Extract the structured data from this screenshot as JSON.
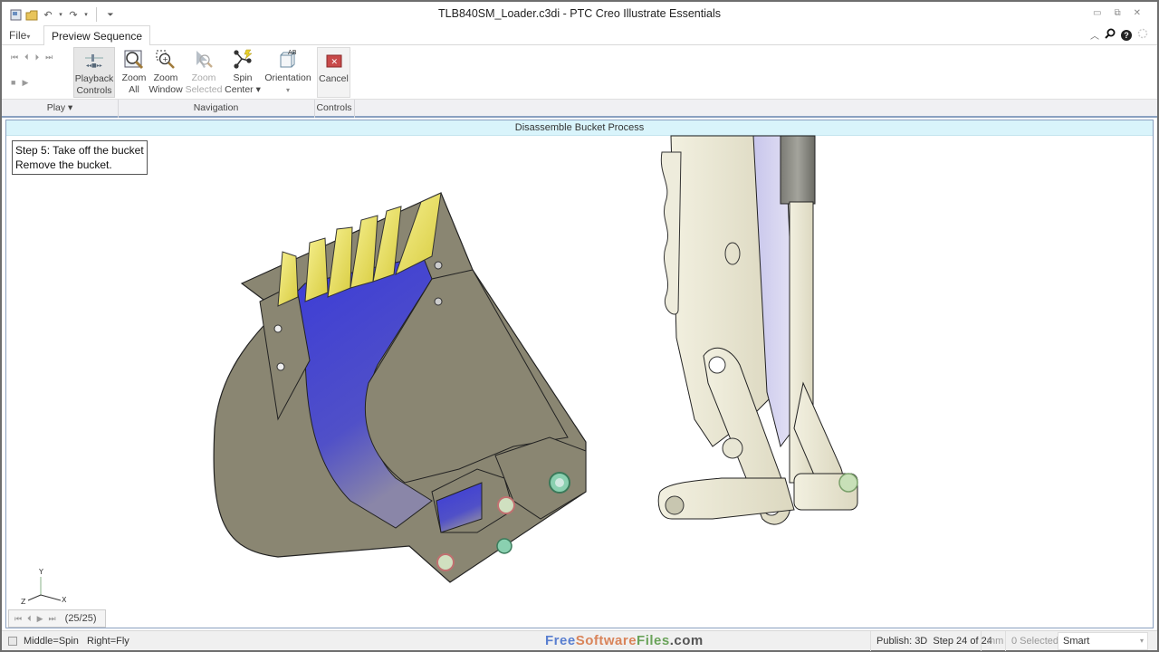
{
  "window": {
    "title": "TLB840SM_Loader.c3di - PTC Creo Illustrate Essentials",
    "quick_access": [
      "app-icon",
      "open-icon",
      "undo-icon",
      "redo-icon",
      "customize-icon"
    ],
    "controls": {
      "minimize": "▭",
      "restore": "⧉",
      "close": "✕"
    }
  },
  "tabs": {
    "file": "File",
    "file_arrow": "▾",
    "active": "Preview Sequence"
  },
  "help_icons": {
    "collapse": "︿",
    "search": "⌕",
    "help": "?"
  },
  "ribbon": {
    "play_controls": [
      "⏮",
      "⏴",
      "⏵",
      "⏭"
    ],
    "play_controls_row2": [
      "■",
      "▶"
    ],
    "buttons": [
      {
        "line1": "Playback",
        "line2": "Controls"
      },
      {
        "line1": "Zoom",
        "line2": "All"
      },
      {
        "line1": "Zoom",
        "line2": "Window"
      },
      {
        "line1": "Zoom",
        "line2": "Selected"
      },
      {
        "line1": "Spin",
        "line2": "Center ▾"
      },
      {
        "line1": "Orientation",
        "line2": "▾"
      },
      {
        "line1": "Cancel",
        "line2": ""
      }
    ],
    "groups": {
      "play": "Play ▾",
      "navigation": "Navigation",
      "controls": "Controls"
    },
    "orientation_badge": "AB"
  },
  "viewport": {
    "header": "Disassemble Bucket Process",
    "step_title": "Step 5: Take off the bucket",
    "step_text": "Remove the bucket.",
    "triad": {
      "y": "Y",
      "x": "X",
      "z": "Z"
    },
    "sequence_counter": "(25/25)",
    "colors": {
      "bucket_body": "#8a8672",
      "bucket_inner": "#4a4ad0",
      "teeth": "#f0ea70",
      "arm": "#ece9d6",
      "arm_shadow": "#c8c6e8",
      "cylinder": "#8a8a84"
    }
  },
  "statusbar": {
    "hint": "Middle=Spin   Right=Fly",
    "brand": {
      "part1": "Free",
      "part2": "Software",
      "part3": "Files",
      "part4": ".com",
      "color1": "#5a7fd0",
      "color2": "#d9845a",
      "color3": "#6aa35a",
      "color4": "#555555"
    },
    "publish": "Publish: 3D  Step 24 of 24",
    "units": "mm",
    "selected": "0 Selected",
    "filter": "Smart"
  }
}
